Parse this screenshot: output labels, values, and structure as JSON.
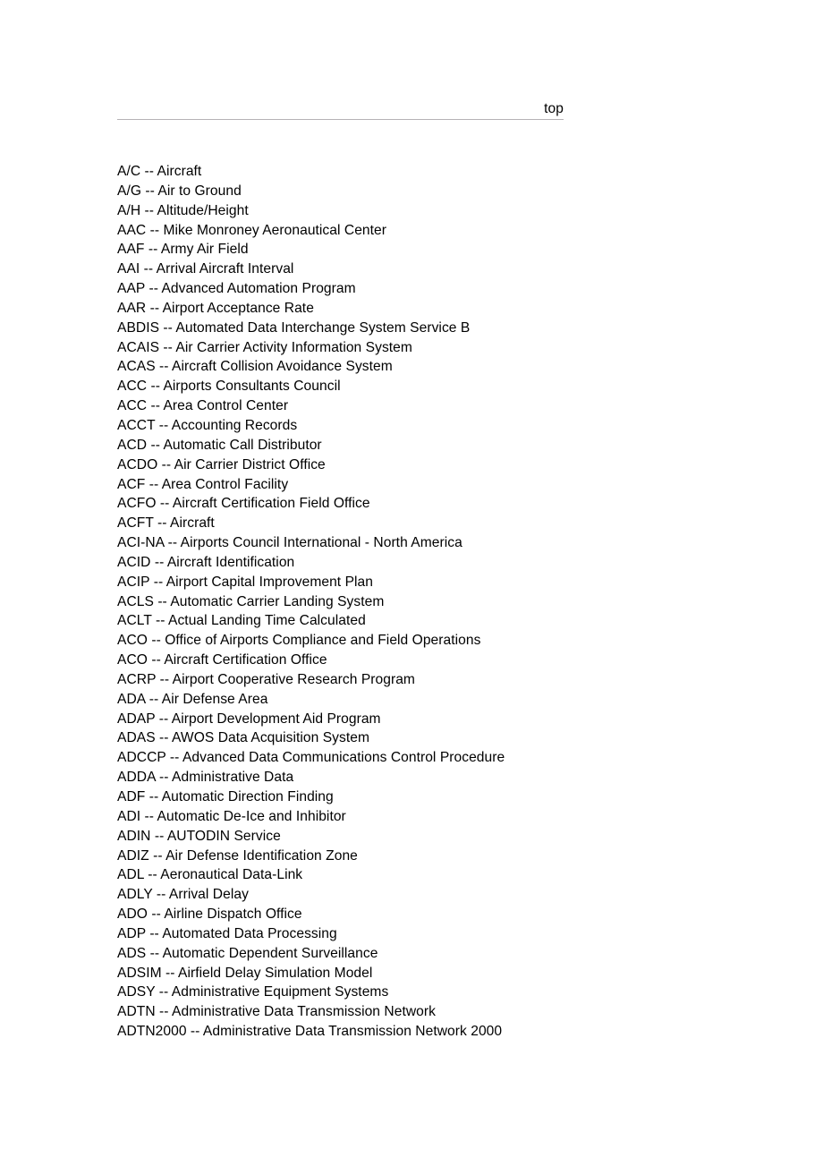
{
  "header": {
    "top_link_label": "top",
    "rule_color": "#b5b2b5"
  },
  "glossary": {
    "entries": [
      "A/C -- Aircraft",
      "A/G -- Air to Ground",
      "A/H -- Altitude/Height",
      "AAC -- Mike Monroney Aeronautical Center",
      "AAF -- Army Air Field",
      "AAI -- Arrival Aircraft Interval",
      "AAP -- Advanced Automation Program",
      "AAR -- Airport Acceptance Rate",
      "ABDIS -- Automated Data Interchange System Service B",
      "ACAIS -- Air Carrier Activity Information System",
      "ACAS -- Aircraft Collision Avoidance System",
      "ACC -- Airports Consultants Council",
      "ACC -- Area Control Center",
      "ACCT -- Accounting Records",
      "ACD -- Automatic Call Distributor",
      "ACDO -- Air Carrier District Office",
      "ACF -- Area Control Facility",
      "ACFO -- Aircraft Certification Field Office",
      "ACFT -- Aircraft",
      "ACI-NA -- Airports Council International - North America",
      "ACID -- Aircraft Identification",
      "ACIP -- Airport Capital Improvement Plan",
      "ACLS -- Automatic Carrier Landing System",
      "ACLT -- Actual Landing Time Calculated",
      "ACO -- Office of Airports Compliance and Field Operations",
      "ACO -- Aircraft Certification Office",
      "ACRP -- Airport Cooperative Research Program",
      "ADA -- Air Defense Area",
      "ADAP -- Airport Development Aid Program",
      "ADAS -- AWOS Data Acquisition System",
      "ADCCP -- Advanced Data Communications Control Procedure",
      "ADDA -- Administrative Data",
      "ADF -- Automatic Direction Finding",
      "ADI -- Automatic De-Ice and Inhibitor",
      "ADIN -- AUTODIN Service",
      "ADIZ -- Air Defense Identification Zone",
      "ADL -- Aeronautical Data-Link",
      "ADLY -- Arrival Delay",
      "ADO -- Airline Dispatch Office",
      "ADP -- Automated Data Processing",
      "ADS -- Automatic Dependent Surveillance",
      "ADSIM -- Airfield Delay Simulation Model",
      "ADSY -- Administrative Equipment Systems",
      "ADTN -- Administrative Data Transmission Network",
      "ADTN2000 -- Administrative Data Transmission Network 2000"
    ]
  }
}
